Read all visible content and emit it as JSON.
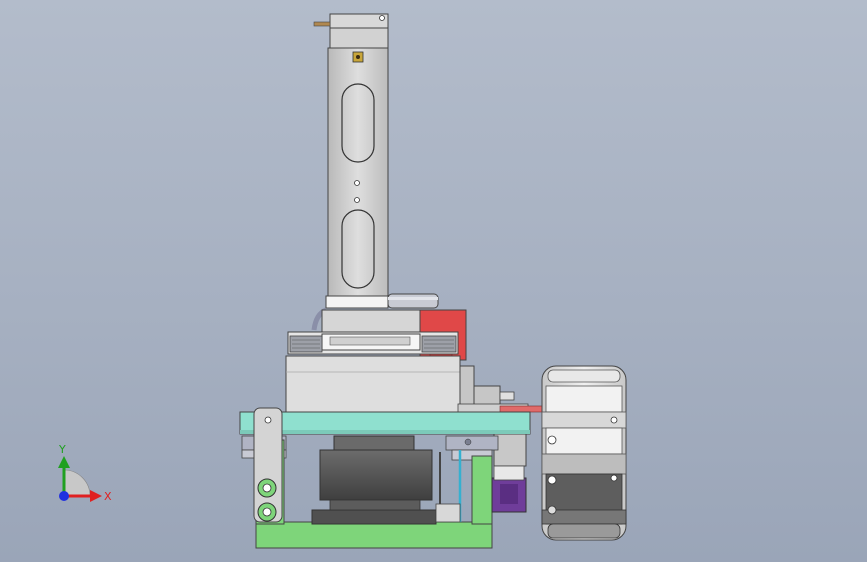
{
  "triad": {
    "x_label": "X",
    "y_label": "Y",
    "colors": {
      "x": "#e02020",
      "y": "#20a020",
      "z": "#2030e0"
    }
  },
  "colors": {
    "frame_green": "#7ed57a",
    "plate_teal": "#8fe0cf",
    "red_block": "#e04848",
    "purple_motor": "#6f3d9a",
    "steel": "#c9c9c9",
    "dark_base": "#555555"
  }
}
